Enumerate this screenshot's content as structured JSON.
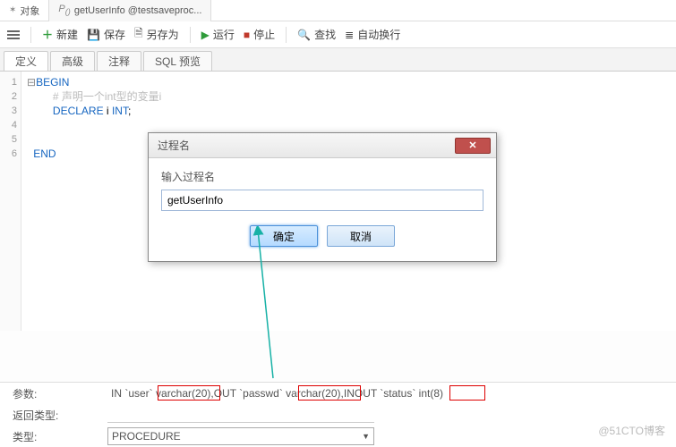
{
  "topTabs": {
    "objects": "对象",
    "fn": "getUserInfo @testsaveproc..."
  },
  "toolbar": {
    "new": "新建",
    "save": "保存",
    "saveAs": "另存为",
    "run": "运行",
    "stop": "停止",
    "find": "查找",
    "wrap": "自动换行"
  },
  "subTabs": {
    "def": "定义",
    "adv": "高级",
    "cmt": "注释",
    "sql": "SQL 预览"
  },
  "code": {
    "l1": "BEGIN",
    "l2a": "# 声明一个",
    "l2b": "int",
    "l2c": "型的变量i",
    "l3a": "DECLARE",
    "l3b": " i ",
    "l3c": "INT",
    "l3d": ";",
    "l6": "END"
  },
  "dialog": {
    "title": "过程名",
    "label": "输入过程名",
    "value": "getUserInfo",
    "ok": "确定",
    "cancel": "取消"
  },
  "footer": {
    "paramsLabel": "参数:",
    "params_p1": "IN `user` ",
    "params_p2": "varchar(20),",
    "params_p3": "OUT `passwd` ",
    "params_p4": "varchar(20),",
    "params_p5": "INOUT `status` ",
    "params_p6": "int(8)",
    "retLabel": "返回类型:",
    "typeLabel": "类型:",
    "typeValue": "PROCEDURE"
  },
  "watermark": "@51CTO博客"
}
